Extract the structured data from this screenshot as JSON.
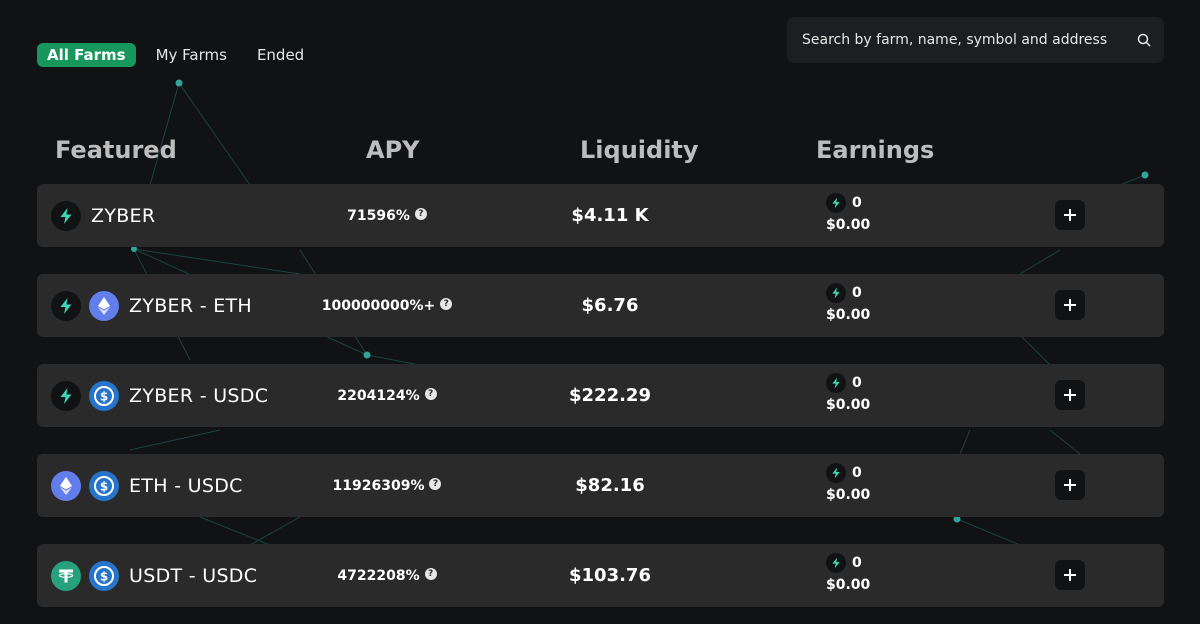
{
  "tabs": [
    {
      "label": "All Farms",
      "active": true
    },
    {
      "label": "My Farms",
      "active": false
    },
    {
      "label": "Ended",
      "active": false
    }
  ],
  "search": {
    "placeholder": "Search by farm, name, symbol and address",
    "icon": "search-icon"
  },
  "columns": {
    "featured": "Featured",
    "apy": "APY",
    "liquidity": "Liquidity",
    "earnings": "Earnings"
  },
  "farms": [
    {
      "pair": "ZYBER",
      "tokens": [
        "zyber"
      ],
      "apy": "71596%",
      "liquidity": "$4.11 K",
      "earned_amount": "0",
      "earned_usd": "$0.00"
    },
    {
      "pair": "ZYBER - ETH",
      "tokens": [
        "zyber",
        "eth"
      ],
      "apy": "100000000%+",
      "liquidity": "$6.76",
      "earned_amount": "0",
      "earned_usd": "$0.00"
    },
    {
      "pair": "ZYBER - USDC",
      "tokens": [
        "zyber",
        "usdc"
      ],
      "apy": "2204124%",
      "liquidity": "$222.29",
      "earned_amount": "0",
      "earned_usd": "$0.00"
    },
    {
      "pair": "ETH - USDC",
      "tokens": [
        "eth",
        "usdc"
      ],
      "apy": "11926309%",
      "liquidity": "$82.16",
      "earned_amount": "0",
      "earned_usd": "$0.00"
    },
    {
      "pair": "USDT - USDC",
      "tokens": [
        "usdt",
        "usdc"
      ],
      "apy": "4722208%",
      "liquidity": "$103.76",
      "earned_amount": "0",
      "earned_usd": "$0.00"
    }
  ],
  "colors": {
    "accent": "#18975c",
    "zyber": "#3ed6b8",
    "eth": "#627eea",
    "usdc": "#2775ca",
    "usdt": "#26a17b",
    "row_bg": "#2a2a2b",
    "page_bg": "#111214"
  }
}
